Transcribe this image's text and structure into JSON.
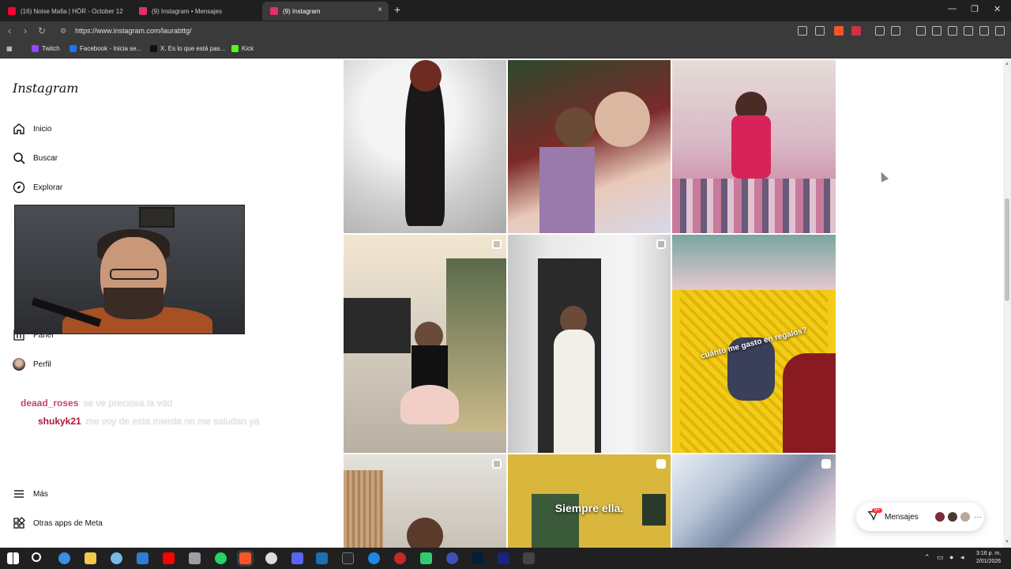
{
  "browser": {
    "tabs": [
      {
        "label": "(16) Noise Mafia | HÖR - October 12",
        "color": "#ff0033"
      },
      {
        "label": "(9) Instagram • Mensajes",
        "color": "#e1306c"
      },
      {
        "label": "(9) Instagram",
        "color": "#e1306c"
      }
    ],
    "new_tab": "+",
    "close_tab": "×",
    "window": {
      "minimize": "—",
      "restore": "❐",
      "close": "✕"
    },
    "url": "https://www.instagram.com/laurabttg/",
    "bookmarks": [
      {
        "label": "Twitch",
        "color": "#9146ff"
      },
      {
        "label": "Facebook - Inicia se...",
        "color": "#1877f2"
      },
      {
        "label": "X. Es lo que está pas...",
        "color": "#111111"
      },
      {
        "label": "Kick",
        "color": "#53fc18"
      }
    ]
  },
  "instagram": {
    "logo": "Instagram",
    "nav": [
      {
        "label": "Inicio",
        "icon": "home-icon"
      },
      {
        "label": "Buscar",
        "icon": "search-icon"
      },
      {
        "label": "Explorar",
        "icon": "compass-icon"
      },
      {
        "label": "Panel",
        "icon": "panel-icon"
      },
      {
        "label": "Perfil",
        "icon": "avatar"
      },
      {
        "label": "Más",
        "icon": "menu-icon"
      },
      {
        "label": "Otras apps de Meta",
        "icon": "apps-icon"
      }
    ],
    "messages_button": {
      "label": "Mensajes",
      "badge": "9+"
    },
    "feed_overlay_text": "Siempre ella.",
    "basket_overlay_text": "cuánto me gasto en regalos?"
  },
  "stream_chat": [
    {
      "user": "deaad_roses",
      "user_color": "#c2456b",
      "message": "se ve preciosa la vdd"
    },
    {
      "user": "shukyk21",
      "user_color": "#b3163a",
      "message": "me voy de esta mierda no me saludan ya"
    }
  ],
  "taskbar": {
    "time": "3:16 p. m.",
    "date": "2/01/2026"
  }
}
